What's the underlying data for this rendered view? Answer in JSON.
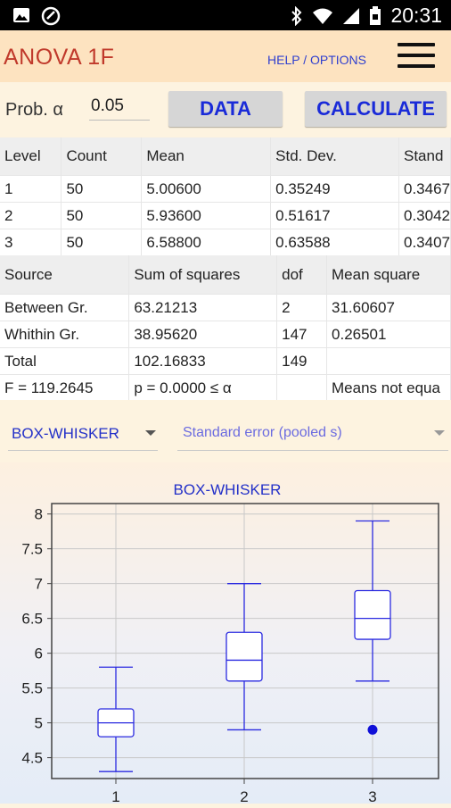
{
  "status_bar": {
    "time": "20:31",
    "left_icons": [
      "image-icon",
      "data-saver-icon"
    ],
    "right_icons": [
      "bluetooth-icon",
      "wifi-icon",
      "signal-icon",
      "battery-icon"
    ]
  },
  "app_bar": {
    "title": "ANOVA 1F",
    "help_label": "HELP / OPTIONS",
    "menu_icon": "hamburger-menu-icon"
  },
  "controls": {
    "prob_label": "Prob. α",
    "prob_value": "0.05",
    "data_button": "DATA",
    "calculate_button": "CALCULATE"
  },
  "levels_table": {
    "headers": [
      "Level",
      "Count",
      "Mean",
      "Std. Dev.",
      "Stand"
    ],
    "rows": [
      [
        "1",
        "50",
        "5.00600",
        "0.35249",
        "0.3467"
      ],
      [
        "2",
        "50",
        "5.93600",
        "0.51617",
        "0.3042"
      ],
      [
        "3",
        "50",
        "6.58800",
        "0.63588",
        "0.3407"
      ]
    ]
  },
  "anova_table": {
    "headers": [
      "Source",
      "Sum of squares",
      "dof",
      "Mean square"
    ],
    "rows": [
      [
        "Between Gr.",
        "63.21213",
        "2",
        "31.60607"
      ],
      [
        "Whithin Gr.",
        "38.95620",
        "147",
        "0.26501"
      ],
      [
        "Total",
        "102.16833",
        "149",
        ""
      ],
      [
        "F = 119.2645",
        "p = 0.0000 ≤ α",
        "",
        "Means not equa"
      ]
    ]
  },
  "selectors": {
    "chart_type": "BOX-WHISKER",
    "error_type": "Standard error (pooled s)"
  },
  "chart_data": {
    "type": "box",
    "title": "BOX-WHISKER",
    "categories": [
      "1",
      "2",
      "3"
    ],
    "ylim": [
      4.2,
      8.15
    ],
    "yticks": [
      "4.5",
      "5",
      "5.5",
      "6",
      "6.5",
      "7",
      "7.5",
      "8"
    ],
    "grid": true,
    "boxes": [
      {
        "category": "1",
        "min": 4.3,
        "q1": 4.8,
        "median": 5.0,
        "q3": 5.2,
        "max": 5.8
      },
      {
        "category": "2",
        "min": 4.9,
        "q1": 5.6,
        "median": 5.9,
        "q3": 6.3,
        "max": 7.0
      },
      {
        "category": "3",
        "min": 5.6,
        "q1": 6.2,
        "median": 6.5,
        "q3": 6.9,
        "max": 7.9
      }
    ],
    "outliers": [
      {
        "category": "3",
        "value": 4.9
      }
    ],
    "colors": {
      "box": "#2a2ae0",
      "outlier": "#1010d8",
      "grid": "#c8c8c8"
    }
  }
}
